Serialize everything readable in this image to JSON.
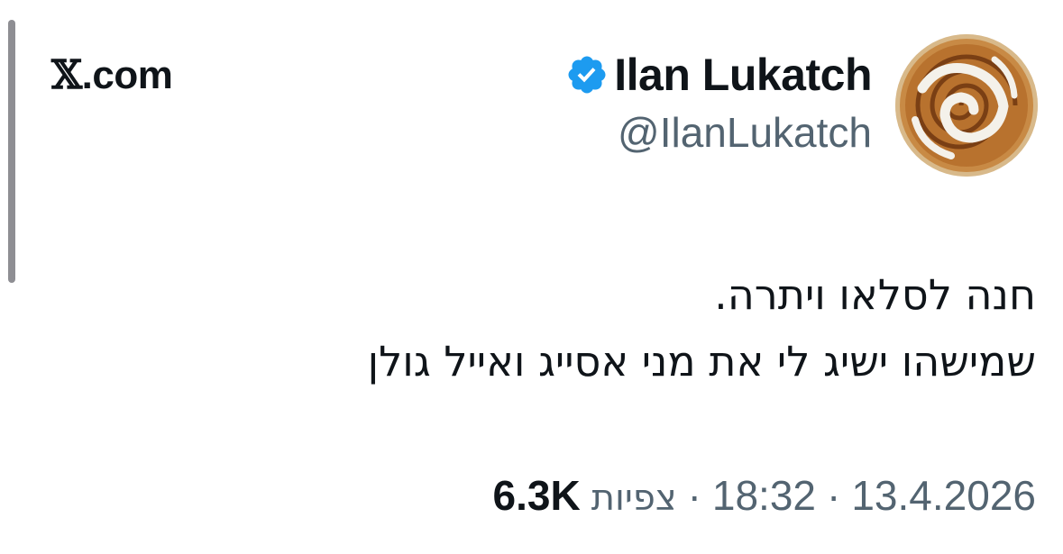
{
  "site": {
    "label": ".com",
    "x_glyph": "𝕏"
  },
  "author": {
    "display_name": "Ilan Lukatch",
    "handle": "@IlanLukatch",
    "verified": true,
    "verified_color": "#1d9bf0",
    "avatar_icon": "cinnamon-roll"
  },
  "tweet": {
    "lines": [
      "חנה לסלאו ויתרה.",
      "שמישהו ישיג לי את מני אסייג ואייל גולן"
    ]
  },
  "meta": {
    "date": "13.4.2026",
    "time": "18:32",
    "separator": "·",
    "views_label": "צפיות",
    "views_count": "6.3K"
  },
  "colors": {
    "text_primary": "#0f1419",
    "text_secondary": "#536471",
    "background": "#ffffff"
  }
}
